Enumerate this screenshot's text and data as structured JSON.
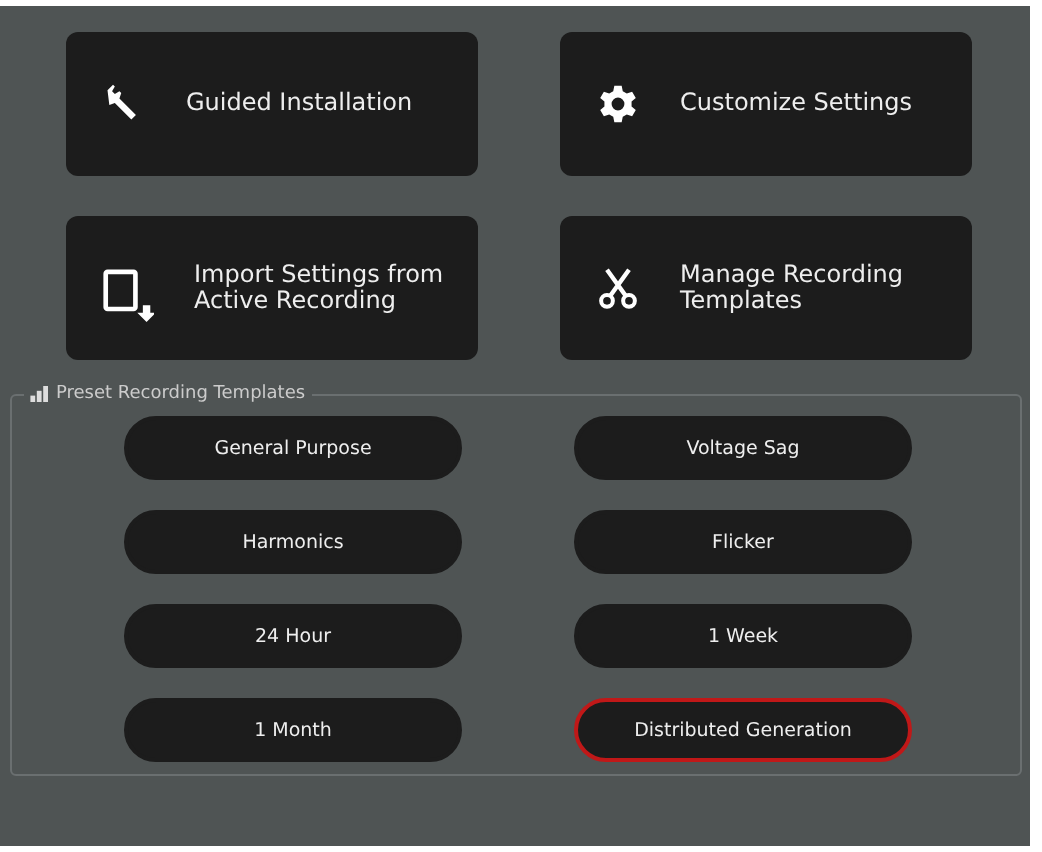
{
  "actions": [
    {
      "kind": "wrench",
      "label": "Guided Installation"
    },
    {
      "kind": "gear",
      "label": "Customize Settings"
    },
    {
      "kind": "import",
      "label": "Import Settings from Active Recording"
    },
    {
      "kind": "scissors",
      "label": "Manage Recording Templates"
    }
  ],
  "presets": {
    "title": "Preset Recording Templates",
    "templates": [
      {
        "label": "General Purpose",
        "selected": false
      },
      {
        "label": "Voltage Sag",
        "selected": false
      },
      {
        "label": "Harmonics",
        "selected": false
      },
      {
        "label": "Flicker",
        "selected": false
      },
      {
        "label": "24 Hour",
        "selected": false
      },
      {
        "label": "1 Week",
        "selected": false
      },
      {
        "label": "1 Month",
        "selected": false
      },
      {
        "label": "Distributed Generation",
        "selected": true
      }
    ]
  }
}
